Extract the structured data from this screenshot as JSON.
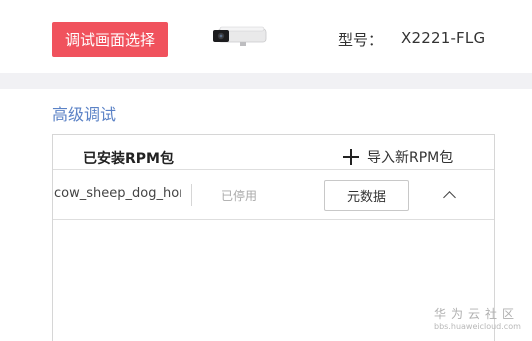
{
  "header": {
    "debug_select_label": "调试画面选择",
    "model_label": "型号：",
    "model_value": "X2221-FLG",
    "camera_icon": "bullet-camera-image"
  },
  "section": {
    "title": "高级调试"
  },
  "panel": {
    "title": "已安装RPM包",
    "import_label": "导入新RPM包",
    "packages": [
      {
        "name": "cow_sheep_dog_horse",
        "status": "已停用",
        "metadata_label": "元数据"
      }
    ]
  },
  "watermark": {
    "title": "华为云社区",
    "url": "bbs.huaweicloud.com"
  },
  "colors": {
    "accent_red": "#f0525d",
    "section_blue": "#5b82c6",
    "separator_gray": "#f1f1f4"
  }
}
